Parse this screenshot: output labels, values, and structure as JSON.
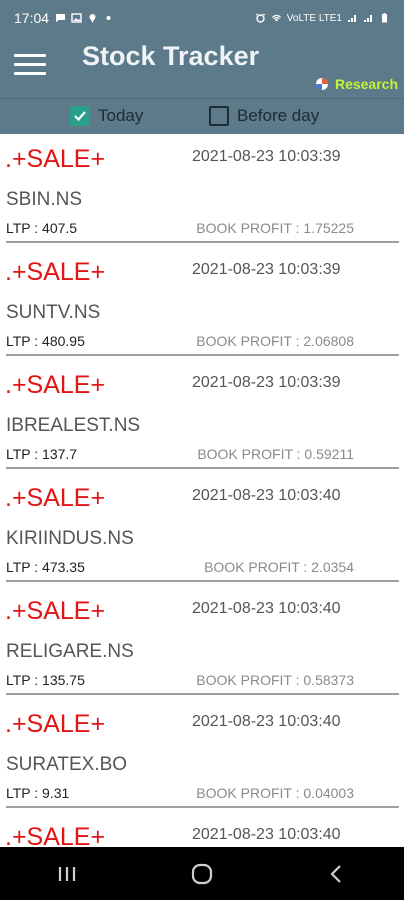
{
  "status_bar": {
    "time": "17:04",
    "network_text": "VoLTE LTE1"
  },
  "app_bar": {
    "title": "Stock Tracker",
    "research_label": "Research",
    "accent_color": "#c4f23b",
    "bar_color": "#5c7a8a"
  },
  "filters": {
    "today": {
      "label": "Today",
      "checked": true
    },
    "before_day": {
      "label": "Before day",
      "checked": false
    }
  },
  "items": [
    {
      "signal": ".+SALE+",
      "timestamp": "2021-08-23 10:03:39",
      "symbol": "SBIN.NS",
      "ltp": "LTP : 407.5",
      "profit": "BOOK PROFIT : 1.75225"
    },
    {
      "signal": ".+SALE+",
      "timestamp": "2021-08-23 10:03:39",
      "symbol": "SUNTV.NS",
      "ltp": "LTP : 480.95",
      "profit": "BOOK PROFIT : 2.06808"
    },
    {
      "signal": ".+SALE+",
      "timestamp": "2021-08-23 10:03:39",
      "symbol": "IBREALEST.NS",
      "ltp": "LTP : 137.7",
      "profit": "BOOK PROFIT : 0.59211"
    },
    {
      "signal": ".+SALE+",
      "timestamp": "2021-08-23 10:03:40",
      "symbol": "KIRIINDUS.NS",
      "ltp": "LTP : 473.35",
      "profit": "BOOK PROFIT : 2.0354"
    },
    {
      "signal": ".+SALE+",
      "timestamp": "2021-08-23 10:03:40",
      "symbol": "RELIGARE.NS",
      "ltp": "LTP : 135.75",
      "profit": "BOOK PROFIT : 0.58373"
    },
    {
      "signal": ".+SALE+",
      "timestamp": "2021-08-23 10:03:40",
      "symbol": "SURATEX.BO",
      "ltp": "LTP : 9.31",
      "profit": "BOOK PROFIT : 0.04003"
    },
    {
      "signal": ".+SALE+",
      "timestamp": "2021-08-23 10:03:40",
      "symbol": "",
      "ltp": "",
      "profit": ""
    }
  ],
  "signal_color": "#e31414",
  "nav": {
    "recents_icon": "recents-icon",
    "home_icon": "home-icon",
    "back_icon": "back-icon"
  }
}
